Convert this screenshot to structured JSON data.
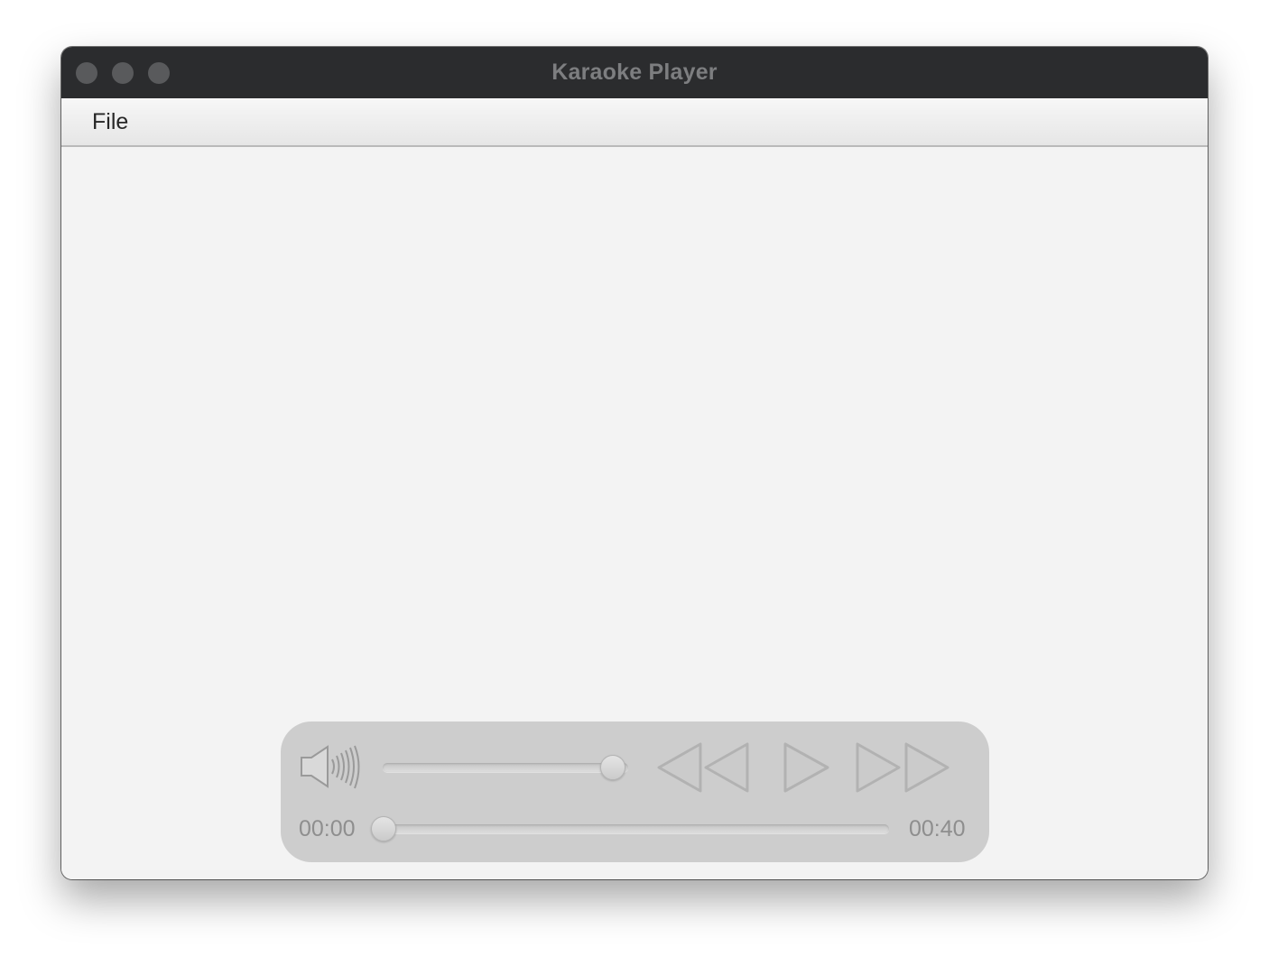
{
  "window": {
    "title": "Karaoke Player"
  },
  "menubar": {
    "items": [
      {
        "label": "File"
      }
    ]
  },
  "player": {
    "current_time": "00:00",
    "total_time": "00:40",
    "volume_fraction": 0.95,
    "seek_fraction": 0.0,
    "icons": {
      "volume": "speaker-volume-icon",
      "rewind": "rewind-icon",
      "play": "play-icon",
      "fast_forward": "fast-forward-icon"
    }
  }
}
